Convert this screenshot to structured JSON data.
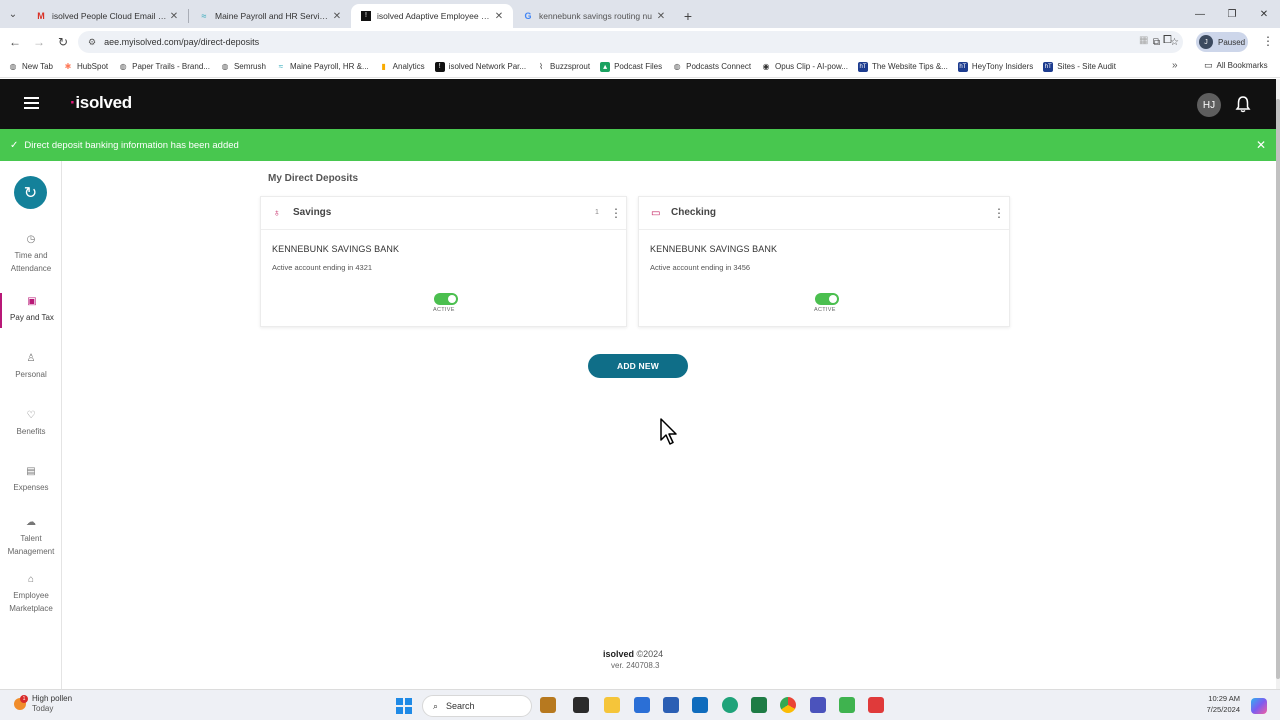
{
  "browser": {
    "tabs": [
      {
        "title": "isolved People Cloud Email Co",
        "icon": "gmail-icon",
        "color": "#d93025",
        "active": false
      },
      {
        "title": "Maine Payroll and HR Services",
        "icon": "maine-payroll-icon",
        "color": "#2aa6b8",
        "active": false
      },
      {
        "title": "isolved Adaptive Employee Exp",
        "icon": "isolved-icon",
        "color": "#111111",
        "active": true
      },
      {
        "title": "kennebunk savings routing nu",
        "icon": "google-icon",
        "color": "#4285f4",
        "active": false
      }
    ],
    "url": "aee.myisolved.com/pay/direct-deposits",
    "profile_status": "Paused",
    "profile_initial": "J",
    "bookmarks": [
      {
        "label": "New Tab",
        "icon": "new-tab-icon"
      },
      {
        "label": "HubSpot",
        "icon": "hubspot-icon"
      },
      {
        "label": "Paper Trails - Brand...",
        "icon": "paper-trails-icon"
      },
      {
        "label": "Semrush",
        "icon": "semrush-icon"
      },
      {
        "label": "Maine Payroll, HR &...",
        "icon": "maine-payroll-icon"
      },
      {
        "label": "Analytics",
        "icon": "analytics-icon"
      },
      {
        "label": "isolved Network Par...",
        "icon": "isolved-icon"
      },
      {
        "label": "Buzzsprout",
        "icon": "buzzsprout-icon"
      },
      {
        "label": "Podcast Files",
        "icon": "podcast-files-icon"
      },
      {
        "label": "Podcasts Connect",
        "icon": "podcasts-connect-icon"
      },
      {
        "label": "Opus Clip - AI-pow...",
        "icon": "opus-clip-icon"
      },
      {
        "label": "The Website Tips &...",
        "icon": "website-tips-icon"
      },
      {
        "label": "HeyTony Insiders",
        "icon": "heytony-icon"
      },
      {
        "label": "Sites - Site Audit",
        "icon": "site-audit-icon"
      }
    ],
    "all_bookmarks": "All Bookmarks"
  },
  "app": {
    "logo": "isolved",
    "user_initials": "HJ",
    "notification": "Direct deposit banking information has been added",
    "brand_color": "#14819a",
    "accent_color": "#b81877",
    "success_color": "#48c74f"
  },
  "sidebar": {
    "items": [
      {
        "label": "Time and Attendance",
        "icon": "clock-icon",
        "active": false
      },
      {
        "label": "Pay and Tax",
        "icon": "pay-icon",
        "active": true
      },
      {
        "label": "Personal",
        "icon": "person-icon",
        "active": false
      },
      {
        "label": "Benefits",
        "icon": "heart-icon",
        "active": false
      },
      {
        "label": "Expenses",
        "icon": "receipt-icon",
        "active": false
      },
      {
        "label": "Talent Management",
        "icon": "cloud-icon",
        "active": false
      },
      {
        "label": "Employee Marketplace",
        "icon": "gift-icon",
        "active": false
      }
    ]
  },
  "main": {
    "title": "My Direct Deposits",
    "cards": [
      {
        "type": "Savings",
        "icon": "piggy-bank-icon",
        "count": "1",
        "bank": "KENNEBUNK SAVINGS BANK",
        "account": "Active account ending in 4321",
        "status": "ACTIVE"
      },
      {
        "type": "Checking",
        "icon": "check-icon",
        "count": "",
        "bank": "KENNEBUNK SAVINGS BANK",
        "account": "Active account ending in 3456",
        "status": "ACTIVE"
      }
    ],
    "add_button": "ADD NEW"
  },
  "footer": {
    "logo": "isolved",
    "copyright": "©2024",
    "version": "ver. 240708.3"
  },
  "taskbar": {
    "weather": "High pollen",
    "weather_sub": "Today",
    "weather_badge": "1",
    "search": "Search",
    "time": "10:29 AM",
    "date": "7/25/2024"
  }
}
